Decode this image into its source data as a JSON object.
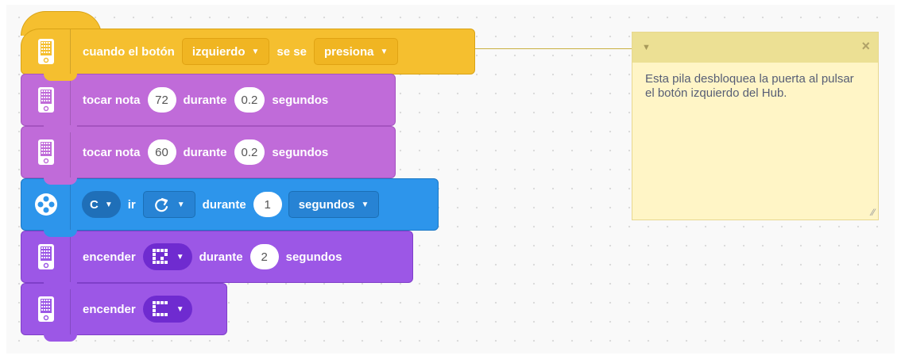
{
  "blocks": {
    "hat": {
      "icon": "hub-icon",
      "text1": "cuando el botón",
      "button_value": "izquierdo",
      "text2": "se se",
      "action_value": "presiona"
    },
    "note1": {
      "icon": "hub-icon",
      "text1": "tocar nota",
      "note": "72",
      "text2": "durante",
      "duration": "0.2",
      "text3": "segundos"
    },
    "note2": {
      "icon": "hub-icon",
      "text1": "tocar nota",
      "note": "60",
      "text2": "durante",
      "duration": "0.2",
      "text3": "segundos"
    },
    "motor": {
      "icon": "motor-icon",
      "port": "C",
      "text1": "ir",
      "direction_icon": "clockwise-arrow-icon",
      "text2": "durante",
      "duration": "1",
      "unit": "segundos"
    },
    "light1": {
      "icon": "hub-icon",
      "text1": "encender",
      "image_icon": "matrix-image-icon",
      "text2": "durante",
      "duration": "2",
      "text3": "segundos"
    },
    "light2": {
      "icon": "hub-icon",
      "text1": "encender",
      "image_icon": "matrix-image-icon"
    }
  },
  "comment": {
    "text": "Esta pila desbloquea la puerta al pulsar el botón izquierdo del Hub."
  },
  "colors": {
    "events": "#f5bf2f",
    "sound": "#c06bd9",
    "motors": "#2d95eb",
    "light": "#9c57e6",
    "comment": "#fff5c6"
  }
}
